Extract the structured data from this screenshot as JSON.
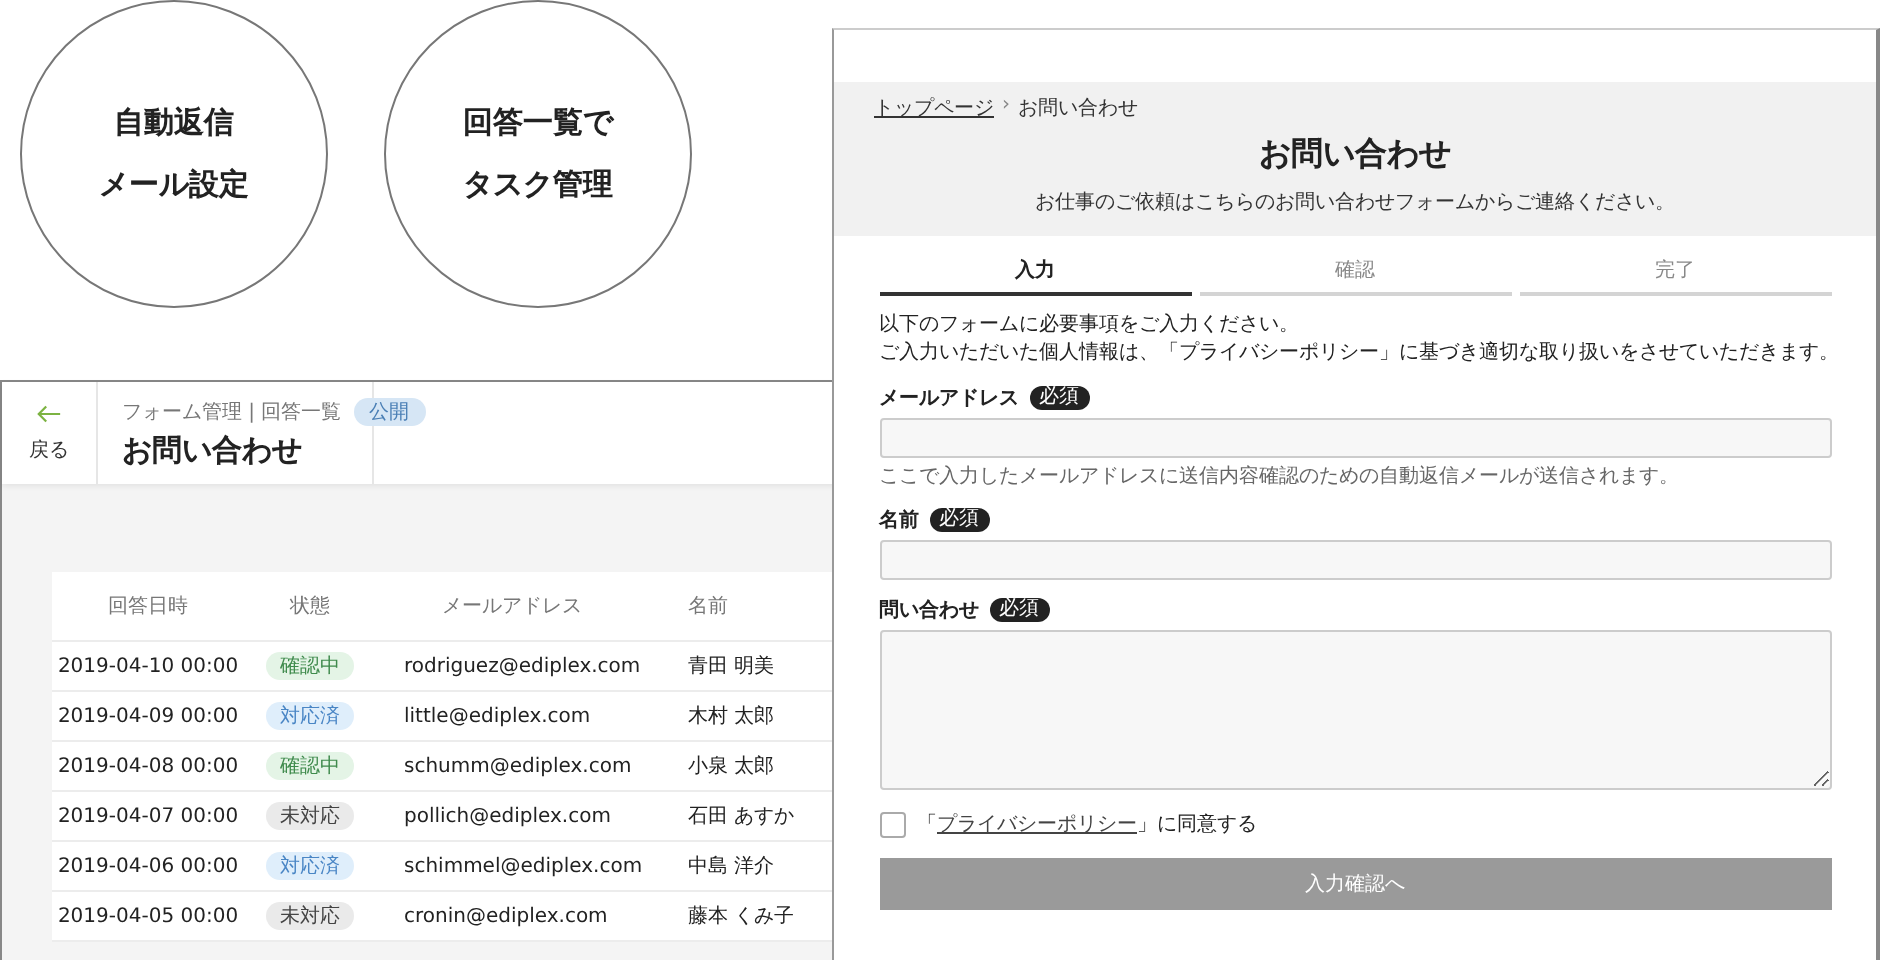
{
  "features": [
    {
      "lines": [
        "自動返信",
        "メール設定"
      ]
    },
    {
      "lines": [
        "回答一覧で",
        "タスク管理"
      ]
    }
  ],
  "admin": {
    "back": "戻る",
    "breadcrumb": "フォーム管理 | 回答一覧",
    "badge": "公開",
    "title": "お問い合わせ",
    "columns": [
      "回答日時",
      "状態",
      "メールアドレス",
      "名前"
    ],
    "rows": [
      {
        "date": "2019-04-10 00:00",
        "status": {
          "label": "確認中",
          "kind": "checking"
        },
        "email": "rodriguez@ediplex.com",
        "name": "青田 明美"
      },
      {
        "date": "2019-04-09 00:00",
        "status": {
          "label": "対応済",
          "kind": "done"
        },
        "email": "little@ediplex.com",
        "name": "木村 太郎"
      },
      {
        "date": "2019-04-08 00:00",
        "status": {
          "label": "確認中",
          "kind": "checking"
        },
        "email": "schumm@ediplex.com",
        "name": "小泉 太郎"
      },
      {
        "date": "2019-04-07 00:00",
        "status": {
          "label": "未対応",
          "kind": "open"
        },
        "email": "pollich@ediplex.com",
        "name": "石田 あすか"
      },
      {
        "date": "2019-04-06 00:00",
        "status": {
          "label": "対応済",
          "kind": "done"
        },
        "email": "schimmel@ediplex.com",
        "name": "中島 洋介"
      },
      {
        "date": "2019-04-05 00:00",
        "status": {
          "label": "未対応",
          "kind": "open"
        },
        "email": "cronin@ediplex.com",
        "name": "藤本 くみ子"
      }
    ]
  },
  "form_page": {
    "breadcrumb_link": "トップページ",
    "separator": "›",
    "breadcrumb_current": "お問い合わせ",
    "title": "お問い合わせ",
    "subtitle": "お仕事のご依頼はこちらのお問い合わせフォームからご連絡ください。",
    "steps": [
      {
        "label": "入力",
        "selected": true
      },
      {
        "label": "確認",
        "selected": false
      },
      {
        "label": "完了",
        "selected": false
      }
    ],
    "intro": [
      "以下のフォームに必要事項をご入力ください。",
      "ご入力いただいた個人情報は、「プライバシーポリシー」に基づき適切な取り扱いをさせていただきます。"
    ],
    "fields": [
      {
        "kind": "input",
        "label": "メールアドレス",
        "required": "必須",
        "hint": "ここで入力したメールアドレスに送信内容確認のための自動返信メールが送信されます。"
      },
      {
        "kind": "input",
        "label": "名前",
        "required": "必須"
      },
      {
        "kind": "textarea",
        "label": "問い合わせ",
        "required": "必須"
      }
    ],
    "consent": {
      "before": "「",
      "link": "プライバシーポリシー",
      "after": "」に同意する",
      "checked": false
    },
    "submit": {
      "label": "入力確認へ",
      "disabled": true
    }
  }
}
